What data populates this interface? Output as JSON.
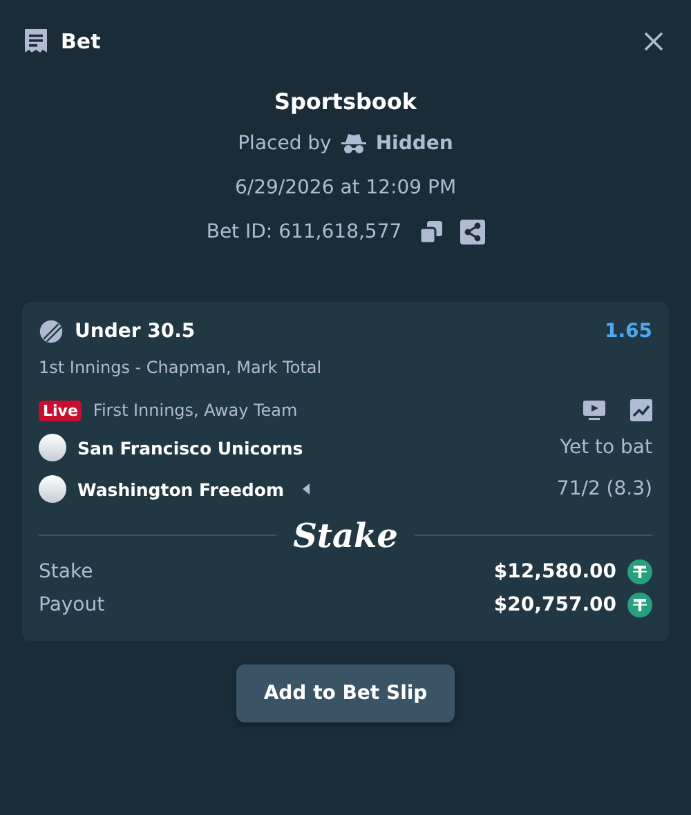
{
  "window": {
    "title": "Bet"
  },
  "summary": {
    "source": "Sportsbook",
    "placed_by_label": "Placed by",
    "placed_by_user": "Hidden",
    "date": "6/29/2026 at 12:09 PM",
    "bet_id": "Bet ID: 611,618,577"
  },
  "selection": {
    "name": "Under 30.5",
    "odds": "1.65",
    "market": "1st Innings - Chapman, Mark Total",
    "live_badge": "Live",
    "status": "First Innings, Away Team",
    "teams": [
      {
        "name": "San Francisco Unicorns",
        "batting": false,
        "score": "Yet to bat"
      },
      {
        "name": "Washington Freedom",
        "batting": true,
        "score": "71/2 (8.3)"
      }
    ]
  },
  "logo": "Stake",
  "amounts": [
    {
      "label": "Stake",
      "value": "$12,580.00"
    },
    {
      "label": "Payout",
      "value": "$20,757.00"
    }
  ],
  "button": "Add to Bet Slip"
}
